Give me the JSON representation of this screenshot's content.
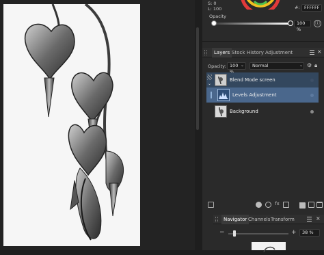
{
  "color": {
    "s_readout": "S: 0",
    "l_readout": "L: 100",
    "hex_prefix": "#:",
    "hex_value": "FFFFFF",
    "opacity_label": "Opacity",
    "opacity_value": "100 %",
    "opacity_fraction": 1.0
  },
  "layers_panel": {
    "tabs": [
      {
        "label": "Layers"
      },
      {
        "label": "Stock"
      },
      {
        "label": "History"
      },
      {
        "label": "Adjustment"
      }
    ],
    "opacity_label": "Opacity:",
    "opacity_value": "100 %",
    "blend_mode": "Normal",
    "layers": [
      {
        "name": "Blend Mode screen"
      },
      {
        "name": "Levels Adjustment"
      },
      {
        "name": "Background"
      }
    ]
  },
  "navigator": {
    "tabs": [
      {
        "label": "Navigator"
      },
      {
        "label": "Channels"
      },
      {
        "label": "Transform"
      }
    ],
    "zoom_minus": "−",
    "zoom_plus": "+",
    "zoom_value": "38 %",
    "zoom_fraction": 0.1
  },
  "colors": {
    "panel_bg": "#2a2a2a",
    "selected_row": "#33475e",
    "selected_row_active": "#4a678c",
    "accent": "#4a8bd6"
  }
}
